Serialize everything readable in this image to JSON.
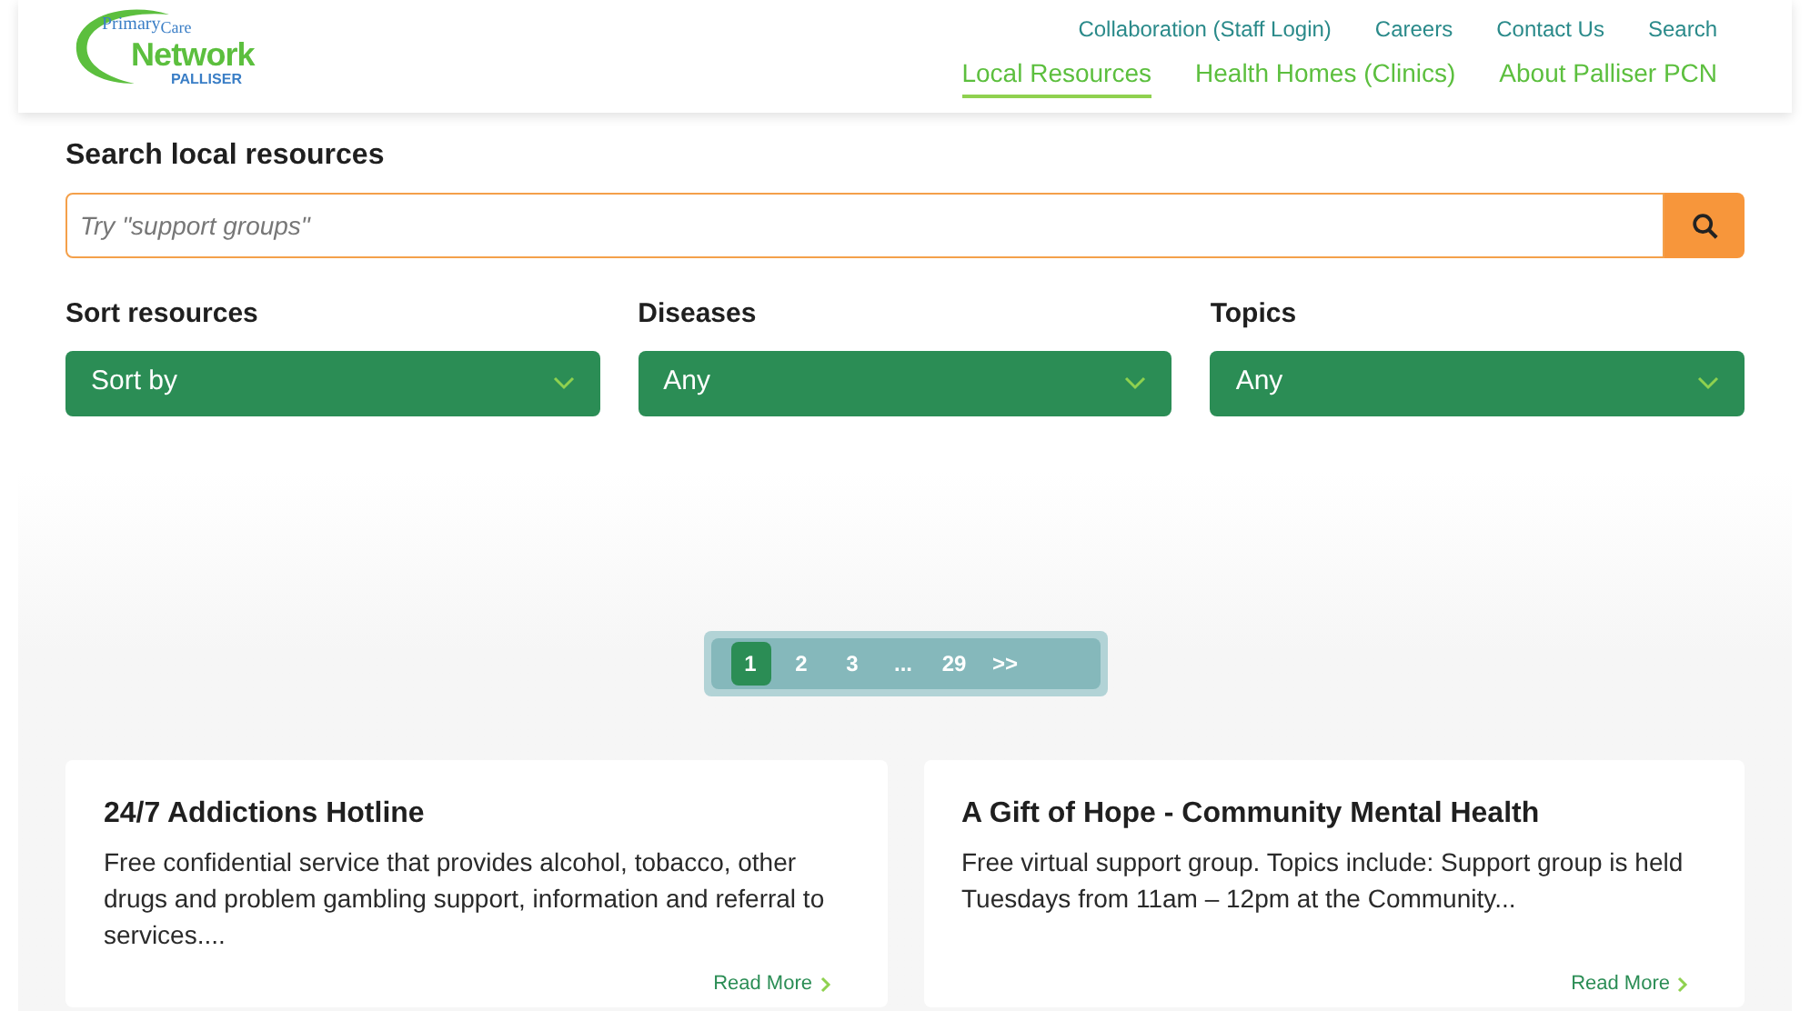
{
  "logo": {
    "line1": "Primary",
    "line2": "Care",
    "line3": "Network",
    "line4": "PALLISER"
  },
  "top_links": [
    "Collaboration (Staff Login)",
    "Careers",
    "Contact Us",
    "Search"
  ],
  "main_nav": [
    {
      "label": "Local Resources",
      "selected": true
    },
    {
      "label": "Health Homes (Clinics)",
      "selected": false
    },
    {
      "label": "About Palliser PCN",
      "selected": false
    }
  ],
  "search": {
    "heading": "Search local resources",
    "placeholder": "Try \"support groups\""
  },
  "filters": [
    {
      "label": "Sort resources",
      "value": "Sort by"
    },
    {
      "label": "Diseases",
      "value": "Any"
    },
    {
      "label": "Topics",
      "value": "Any"
    }
  ],
  "pagination": [
    {
      "label": "1",
      "selected": true
    },
    {
      "label": "2",
      "selected": false
    },
    {
      "label": "3",
      "selected": false
    },
    {
      "label": "...",
      "selected": false
    },
    {
      "label": "29",
      "selected": false
    },
    {
      "label": ">>",
      "selected": false
    }
  ],
  "cards": [
    {
      "title": "24/7 Addictions Hotline",
      "description": "Free confidential service that provides alcohol, tobacco, other drugs and problem gambling support, information and referral to services....",
      "link": "Read More"
    },
    {
      "title": "A Gift of Hope - Community Mental Health",
      "description": "Free virtual support group. Topics include: Support group is held Tuesdays from 11am – 12pm at the Community...",
      "link": "Read More"
    }
  ]
}
